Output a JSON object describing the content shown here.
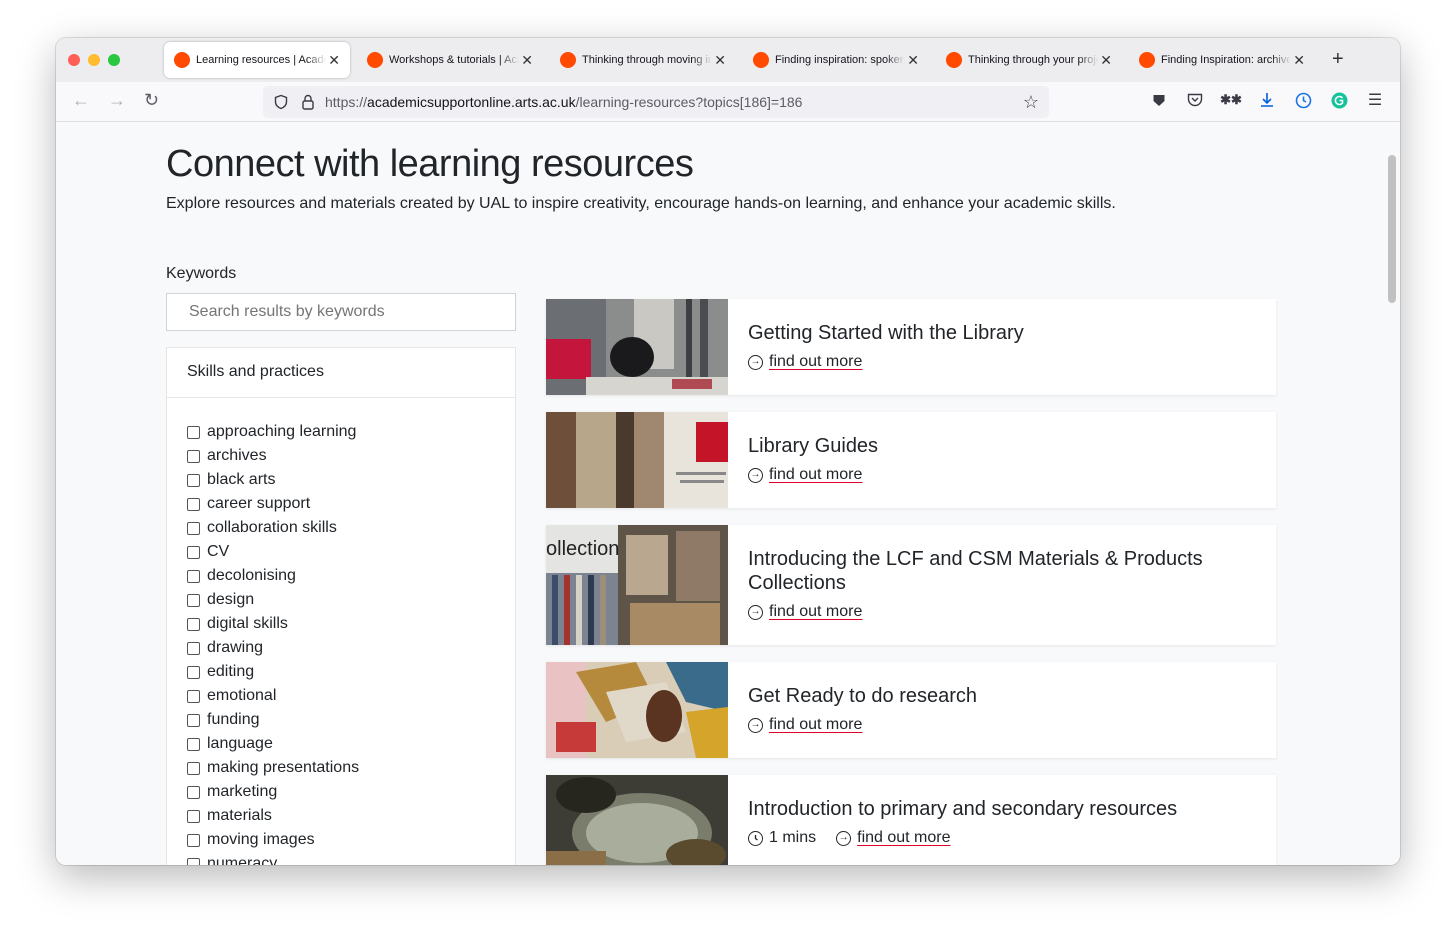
{
  "browser": {
    "tabs": [
      {
        "title": "Learning resources | Academic Support Online",
        "active": true
      },
      {
        "title": "Workshops & tutorials | Academic Support",
        "active": false
      },
      {
        "title": "Thinking through moving images",
        "active": false
      },
      {
        "title": "Finding inspiration: spoken word",
        "active": false
      },
      {
        "title": "Thinking through your project",
        "active": false
      },
      {
        "title": "Finding Inspiration: archives",
        "active": false
      }
    ],
    "url_prefix": "https://",
    "url_host": "academicsupportonline.arts.ac.uk",
    "url_path": "/learning-resources?topics[186]=186"
  },
  "page": {
    "title": "Connect with learning resources",
    "intro": "Explore resources and materials created by UAL to inspire creativity, encourage hands-on learning, and enhance your academic skills.",
    "keywords_label": "Keywords",
    "search_placeholder": "Search results by keywords",
    "filter_heading": "Skills and practices",
    "filters": [
      "approaching learning",
      "archives",
      "black arts",
      "career support",
      "collaboration skills",
      "CV",
      "decolonising",
      "design",
      "digital skills",
      "drawing",
      "editing",
      "emotional",
      "funding",
      "language",
      "making presentations",
      "marketing",
      "materials",
      "moving images",
      "numeracy"
    ],
    "link_label": "find out more",
    "resources": [
      {
        "title": "Getting Started with the Library",
        "duration": ""
      },
      {
        "title": "Library Guides",
        "duration": ""
      },
      {
        "title": "Introducing the LCF and CSM Materials & Products Collections",
        "duration": ""
      },
      {
        "title": "Get Ready to do research",
        "duration": ""
      },
      {
        "title": "Introduction to primary and secondary resources",
        "duration": "1 mins"
      }
    ],
    "thumb_text": "ollection"
  },
  "colors": {
    "accent_underline": "#e0002a",
    "favicon": "#ff4a00"
  }
}
